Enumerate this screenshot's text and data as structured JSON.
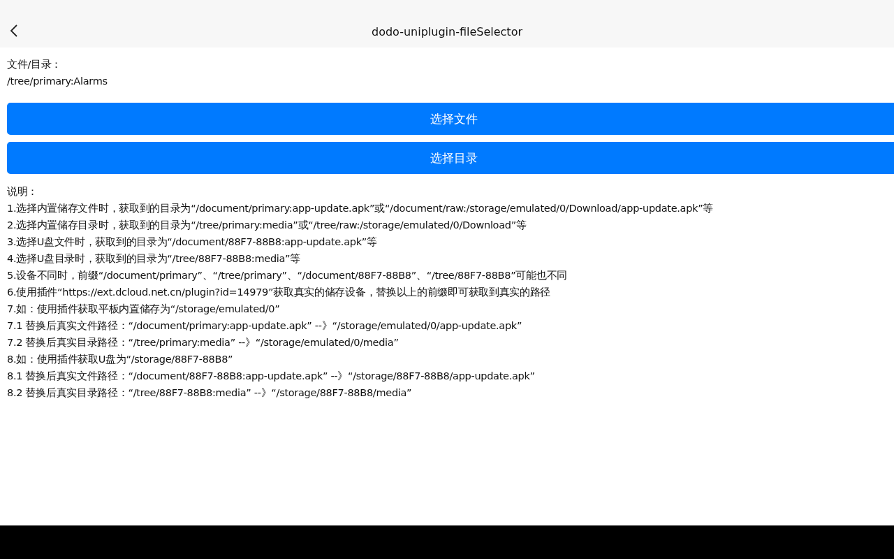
{
  "nav_bar": {
    "title": "dodo-uniplugin-fileSelector"
  },
  "selection": {
    "label": "文件/目录：",
    "path": "/tree/primary:Alarms"
  },
  "buttons": [
    "选择文件",
    "选择目录"
  ],
  "notes": {
    "heading": "说明：",
    "lines": [
      "1.选择内置储存文件时，获取到的目录为“/document/primary:app-update.apk”或“/document/raw:/storage/emulated/0/Download/app-update.apk”等",
      "2.选择内置储存目录时，获取到的目录为“/tree/primary:media”或“/tree/raw:/storage/emulated/0/Download”等",
      "3.选择U盘文件时，获取到的目录为“/document/88F7-88B8:app-update.apk”等",
      "4.选择U盘目录时，获取到的目录为“/tree/88F7-88B8:media”等",
      "5.设备不同时，前缀“/document/primary”、“/tree/primary”、“/document/88F7-88B8”、“/tree/88F7-88B8”可能也不同",
      "6.使用插件“https://ext.dcloud.net.cn/plugin?id=14979”获取真实的储存设备，替换以上的前缀即可获取到真实的路径",
      "7.如：使用插件获取平板内置储存为“/storage/emulated/0”",
      "7.1 替换后真实文件路径：“/document/primary:app-update.apk” --》“/storage/emulated/0/app-update.apk”",
      "7.2 替换后真实目录路径：“/tree/primary:media” --》“/storage/emulated/0/media”",
      "8.如：使用插件获取U盘为“/storage/88F7-88B8”",
      "8.1 替换后真实文件路径：“/document/88F7-88B8:app-update.apk” --》“/storage/88F7-88B8/app-update.apk”",
      "8.2 替换后真实目录路径：“/tree/88F7-88B8:media” --》“/storage/88F7-88B8/media”"
    ]
  }
}
